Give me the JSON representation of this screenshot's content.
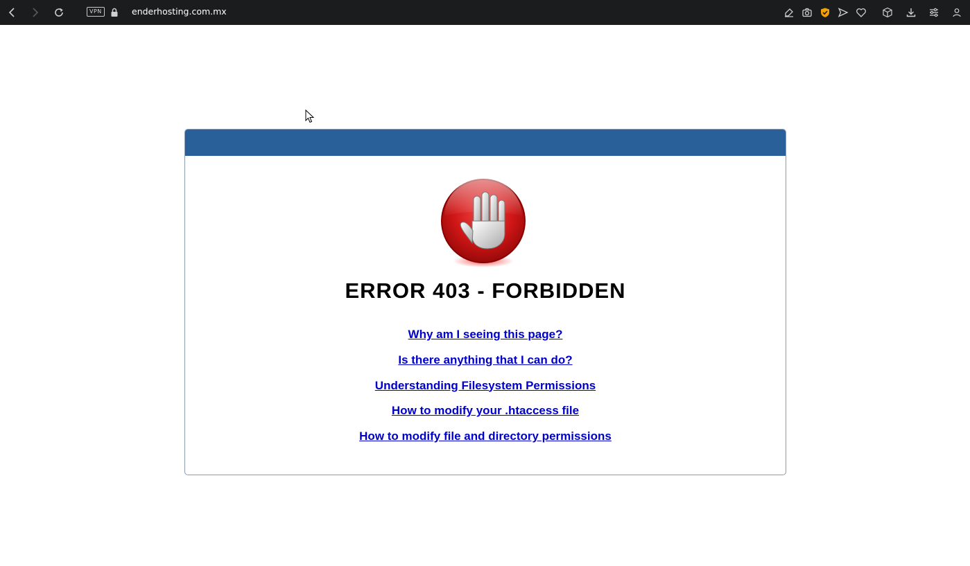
{
  "browser": {
    "url": "enderhosting.com.mx",
    "vpn_label": "VPN",
    "toolbar_icons_left": [
      "back-icon",
      "forward-icon",
      "reload-icon"
    ],
    "toolbar_icons_right": [
      "snap-edit-icon",
      "camera-icon",
      "shield-icon",
      "send-icon",
      "heart-icon",
      "cube-icon",
      "download-icon",
      "settings-sliders-icon",
      "profile-icon"
    ],
    "accent_color": "#f5a000"
  },
  "page": {
    "header_color": "#2a6099",
    "title": "ERROR 403 - FORBIDDEN",
    "icon": "stop-hand-icon",
    "links": [
      "Why am I seeing this page?",
      "Is there anything that I can do?",
      "Understanding Filesystem Permissions",
      "How to modify your .htaccess file",
      "How to modify file and directory permissions"
    ],
    "link_color": "#0000cc"
  }
}
